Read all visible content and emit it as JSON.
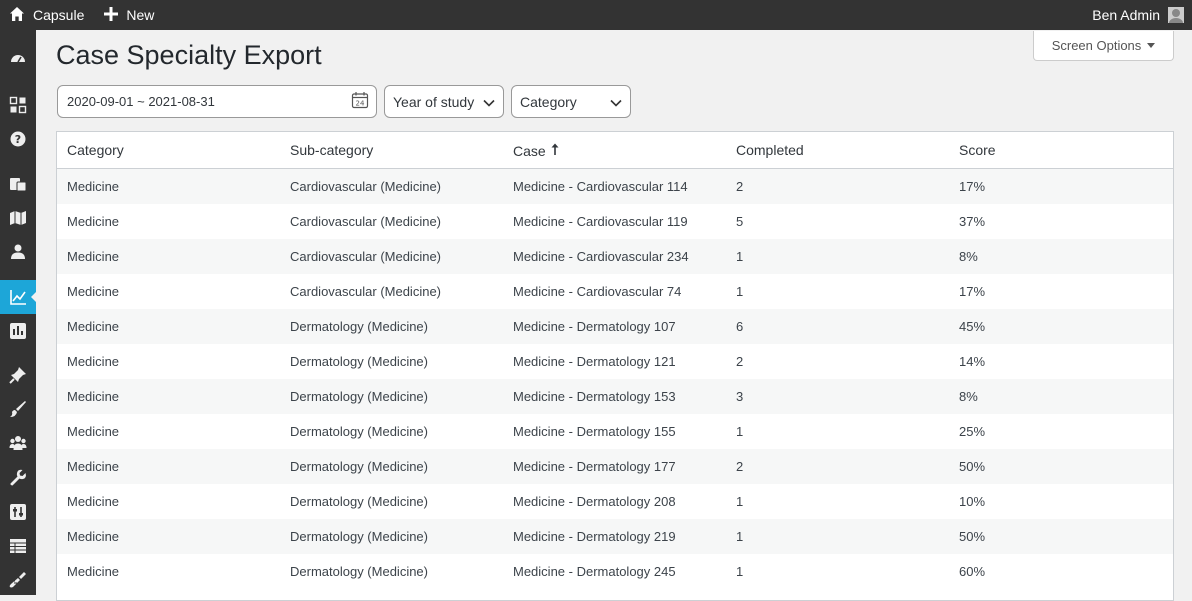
{
  "topbar": {
    "site_name": "Capsule",
    "new_label": "New",
    "user_name": "Ben Admin"
  },
  "sidebar": {
    "icons": [
      "dashboard-icon",
      "apps-grid-icon",
      "help-icon",
      "cases-icon",
      "map-icon",
      "user-icon",
      "analytics-icon",
      "reports-icon",
      "pin-icon",
      "brush-icon",
      "groups-icon",
      "wrench-icon",
      "settings-icon",
      "table-icon",
      "tools-icon"
    ],
    "active": "analytics-icon",
    "accent_color": "#1da6d8"
  },
  "page": {
    "title": "Case Specialty Export",
    "screen_options_label": "Screen Options"
  },
  "filters": {
    "date_range": "2020-09-01 ~ 2021-08-31",
    "calendar_day": "24",
    "year_of_study": "Year of study",
    "category": "Category"
  },
  "table": {
    "columns": [
      "Category",
      "Sub-category",
      "Case",
      "Completed",
      "Score"
    ],
    "sorted_column": "Case",
    "sort_direction": "ascending",
    "rows": [
      [
        "Medicine",
        "Cardiovascular (Medicine)",
        "Medicine - Cardiovascular 114",
        "2",
        "17%"
      ],
      [
        "Medicine",
        "Cardiovascular (Medicine)",
        "Medicine - Cardiovascular 119",
        "5",
        "37%"
      ],
      [
        "Medicine",
        "Cardiovascular (Medicine)",
        "Medicine - Cardiovascular 234",
        "1",
        "8%"
      ],
      [
        "Medicine",
        "Cardiovascular (Medicine)",
        "Medicine - Cardiovascular 74",
        "1",
        "17%"
      ],
      [
        "Medicine",
        "Dermatology (Medicine)",
        "Medicine - Dermatology 107",
        "6",
        "45%"
      ],
      [
        "Medicine",
        "Dermatology (Medicine)",
        "Medicine - Dermatology 121",
        "2",
        "14%"
      ],
      [
        "Medicine",
        "Dermatology (Medicine)",
        "Medicine - Dermatology 153",
        "3",
        "8%"
      ],
      [
        "Medicine",
        "Dermatology (Medicine)",
        "Medicine - Dermatology 155",
        "1",
        "25%"
      ],
      [
        "Medicine",
        "Dermatology (Medicine)",
        "Medicine - Dermatology 177",
        "2",
        "50%"
      ],
      [
        "Medicine",
        "Dermatology (Medicine)",
        "Medicine - Dermatology 208",
        "1",
        "10%"
      ],
      [
        "Medicine",
        "Dermatology (Medicine)",
        "Medicine - Dermatology 219",
        "1",
        "50%"
      ],
      [
        "Medicine",
        "Dermatology (Medicine)",
        "Medicine - Dermatology 245",
        "1",
        "60%"
      ]
    ]
  }
}
